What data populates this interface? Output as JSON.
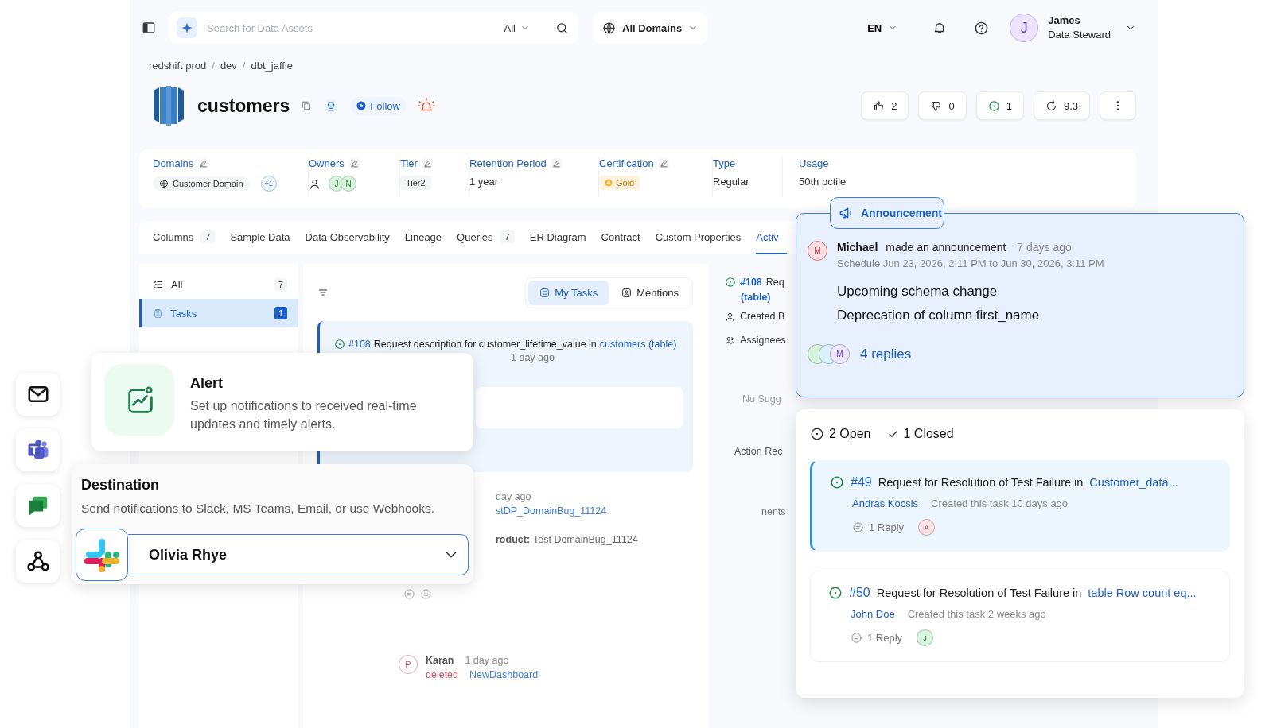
{
  "top_bar": {
    "search": {
      "placeholder": "Search for Data Assets",
      "filter": "All"
    },
    "domain": "All Domains",
    "language": "EN",
    "user": {
      "initial": "J",
      "name": "James",
      "role": "Data Steward"
    }
  },
  "breadcrumb": [
    {
      "kind": "link",
      "label": "redshift prod"
    },
    {
      "kind": "separator",
      "label": "/"
    },
    {
      "kind": "link",
      "label": "dev"
    },
    {
      "kind": "separator",
      "label": "/"
    },
    {
      "kind": "link",
      "label": "dbt_jaffle"
    }
  ],
  "asset": {
    "name": "customers",
    "follow": "Follow",
    "stats": [
      {
        "kind": "up",
        "value": "2"
      },
      {
        "kind": "down",
        "value": "0"
      },
      {
        "kind": "tasks",
        "value": "1"
      },
      {
        "kind": "score",
        "value": "9.3"
      }
    ]
  },
  "metadata": [
    {
      "label": "Domains",
      "kind": "domain",
      "editable": true,
      "value": "Customer Domain",
      "extra": "+1"
    },
    {
      "label": "Owners",
      "kind": "owners",
      "editable": true,
      "avatars": [
        {
          "initial": "J",
          "color": "#d6f5dc"
        },
        {
          "initial": "N",
          "color": "#d6f5dc"
        }
      ]
    },
    {
      "label": "Tier",
      "kind": "tag",
      "editable": true,
      "value": "Tier2"
    },
    {
      "label": "Retention Period",
      "kind": "text",
      "editable": true,
      "value": "1 year"
    },
    {
      "label": "Certification",
      "kind": "cert",
      "editable": true,
      "value": "Gold"
    },
    {
      "label": "Type",
      "kind": "text",
      "editable": false,
      "value": "Regular"
    },
    {
      "label": "Usage",
      "kind": "text",
      "editable": false,
      "value": "50th pctile"
    }
  ],
  "tabs": [
    {
      "label": "Columns",
      "count": "7",
      "selected": false
    },
    {
      "label": "Sample Data",
      "selected": false
    },
    {
      "label": "Data Observability",
      "selected": false
    },
    {
      "label": "Lineage",
      "selected": false
    },
    {
      "label": "Queries",
      "count": "7",
      "selected": false
    },
    {
      "label": "ER Diagram",
      "selected": false
    },
    {
      "label": "Contract",
      "selected": false
    },
    {
      "label": "Custom Properties",
      "selected": false
    },
    {
      "label": "Activ",
      "selected": true
    }
  ],
  "feed_filters": [
    {
      "label": "All",
      "count": "7",
      "selected": false
    },
    {
      "label": "Tasks",
      "count": "1",
      "selected": true
    }
  ],
  "task_toggle": [
    {
      "label": "My Tasks",
      "selected": true
    },
    {
      "label": "Mentions",
      "selected": false
    }
  ],
  "feed": {
    "task": {
      "number": "#108",
      "text": "Request description for customer_lifetime_value in",
      "link": "customers (table)",
      "time": "1 day ago"
    },
    "second": {
      "time": "day ago",
      "link": "stDP_DomainBug_11124",
      "label": "roduct:",
      "value": "Test DomainBug_11124"
    },
    "faded": {
      "avatar": "P",
      "user": "Karan",
      "time": "1 day ago",
      "action": "deleted",
      "target": "NewDashboard"
    }
  },
  "details_panel": {
    "number": "#108",
    "title": "Req",
    "link": "(table)",
    "created": "Created B",
    "assignees": "Assignees",
    "suggestion": "No Sugg",
    "action": "Action Rec",
    "comments": "nents"
  },
  "channels": [
    {
      "kind": "email"
    },
    {
      "kind": "teams"
    },
    {
      "kind": "chat"
    },
    {
      "kind": "webhook"
    }
  ],
  "alert": {
    "title": "Alert",
    "description": "Set up notifications to received real-time updates and timely alerts."
  },
  "destination": {
    "title": "Destination",
    "description": "Send notifications to Slack, MS Teams, Email, or use Webhooks.",
    "value": "Olivia Rhye"
  },
  "announcement": {
    "label": "Announcement",
    "avatar": {
      "initial": "M",
      "color": "#fde0e2"
    },
    "author": "Michael",
    "action": "made an announcement",
    "time": "7 days ago",
    "schedule": "Schedule Jun 23, 2026, 2:11 PM to Jun 30, 2026, 3:11 PM",
    "lines": [
      "Upcoming schema change",
      "Deprecation of column first_name"
    ],
    "reply_avatars": [
      {
        "color": "#d6f5dc"
      },
      {
        "color": "#d9f1fb"
      },
      {
        "initial": "M",
        "color": "#ebe5fd"
      }
    ],
    "replies": "4 replies"
  },
  "tasks": {
    "open": "2 Open",
    "closed": "1 Closed",
    "items": [
      {
        "number": "#49",
        "text": "Request for Resolution of Test Failure in",
        "link": "Customer_data...",
        "author": "Andras Kocsis",
        "created": "Created this task 10 days ago",
        "replies": "1 Reply",
        "avatar": "A",
        "color": "#fde0e2",
        "selected": true
      },
      {
        "number": "#50",
        "text": "Request for Resolution of Test Failure in",
        "link": "table Row count eq...",
        "author": "John Doe",
        "created": "Created this task 2 weeks ago",
        "replies": "1 Reply",
        "avatar": "J",
        "color": "#d6f5dc",
        "selected": false
      }
    ]
  }
}
